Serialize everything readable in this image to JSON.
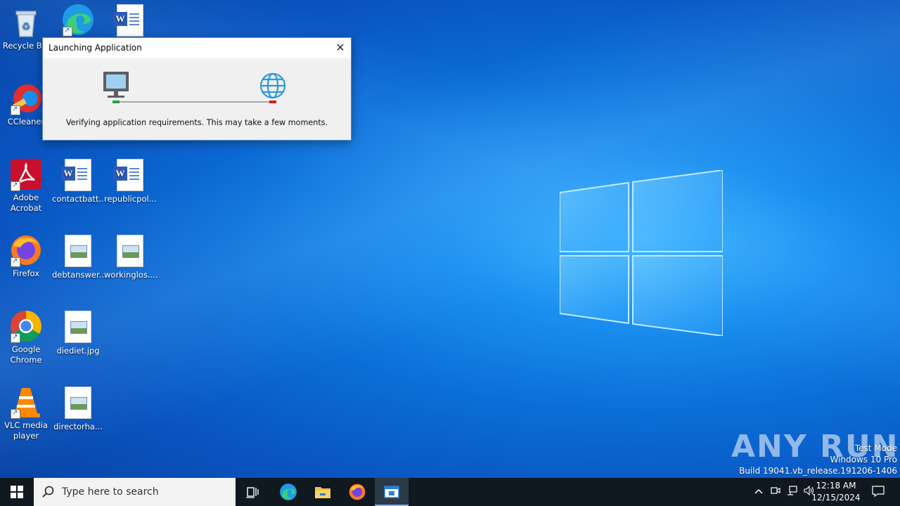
{
  "desktop": {
    "icons": [
      {
        "label": "Recycle Bin",
        "type": "recycle"
      },
      {
        "label": "",
        "type": "edge"
      },
      {
        "label": "",
        "type": "word"
      },
      {
        "label": "CCleaner",
        "type": "ccleaner"
      },
      {
        "label": "Adobe Acrobat",
        "type": "acrobat"
      },
      {
        "label": "contactbatt...",
        "type": "word"
      },
      {
        "label": "republicpol...",
        "type": "word"
      },
      {
        "label": "Firefox",
        "type": "firefox"
      },
      {
        "label": "debtanswer...",
        "type": "image"
      },
      {
        "label": "workinglos....",
        "type": "image"
      },
      {
        "label": "Google Chrome",
        "type": "chrome"
      },
      {
        "label": "diediet.jpg",
        "type": "image"
      },
      {
        "label": "VLC media player",
        "type": "vlc"
      },
      {
        "label": "directorha...",
        "type": "image"
      }
    ]
  },
  "dialog": {
    "title": "Launching Application",
    "close_glyph": "✕",
    "message": "Verifying application requirements. This may take a few moments."
  },
  "watermark": {
    "brand": "ANY RUN",
    "line1": "Test Mode",
    "line2": "Windows 10 Pro",
    "line3": "Build 19041.vb_release.191206-1406"
  },
  "taskbar": {
    "search_placeholder": "Type here to search",
    "clock_time": "12:18 AM",
    "clock_date": "12/15/2024"
  }
}
